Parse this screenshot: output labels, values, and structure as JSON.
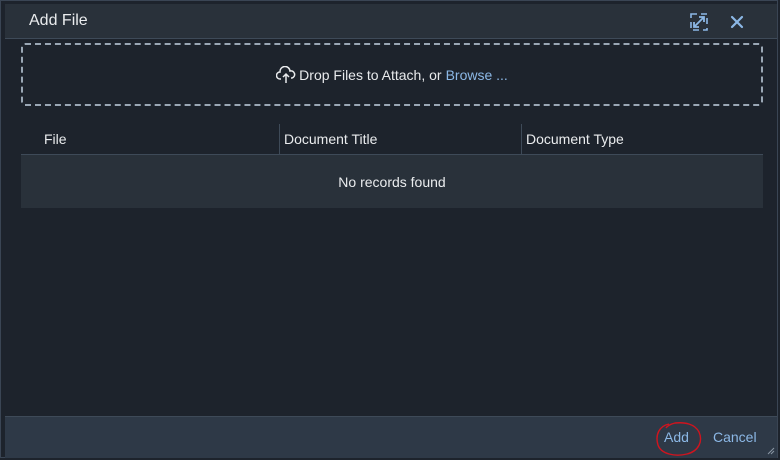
{
  "dialog": {
    "title": "Add File",
    "header_icons": [
      "expand-icon",
      "close-icon"
    ]
  },
  "dropzone": {
    "text": "Drop Files to Attach, or",
    "browse_label": "Browse ...",
    "icon": "cloud-upload-icon"
  },
  "table": {
    "columns": [
      "File",
      "Document Title",
      "Document Type"
    ],
    "empty_text": "No records found"
  },
  "footer": {
    "add_label": "Add",
    "cancel_label": "Cancel"
  },
  "colors": {
    "background": "#1d232c",
    "header": "#29313a",
    "footer": "#2e3947",
    "link": "#8cb8e6",
    "annotation": "#d0141e"
  }
}
